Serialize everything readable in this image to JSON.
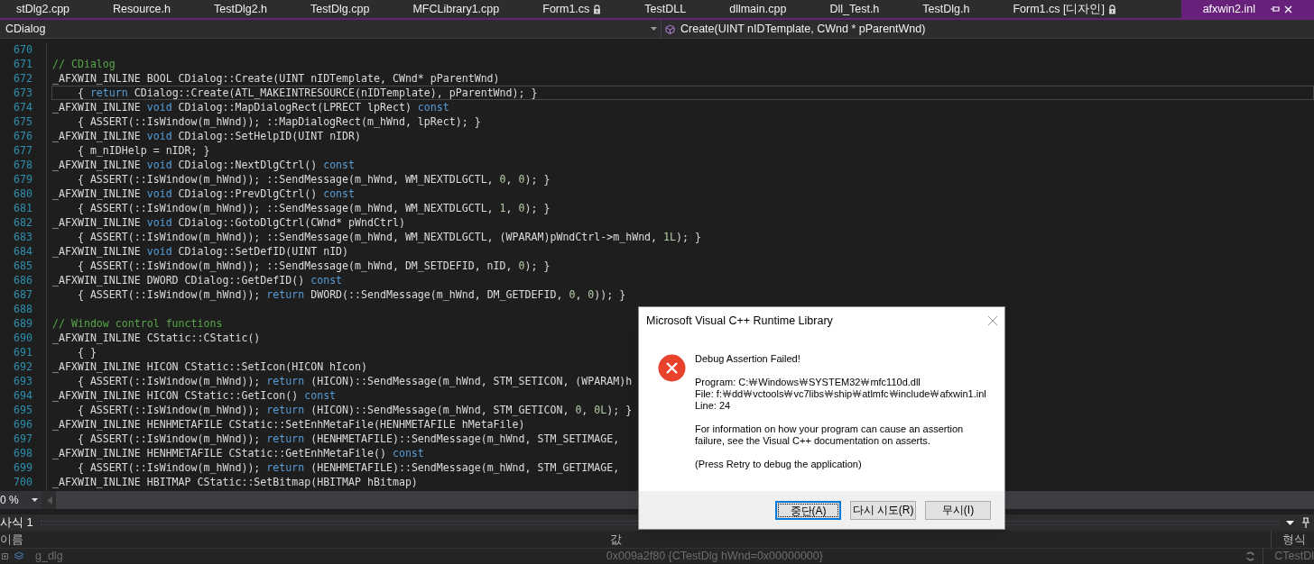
{
  "tabs": [
    {
      "label": "stDlg2.cpp",
      "selected": false,
      "locked": false
    },
    {
      "label": "Resource.h",
      "selected": false,
      "locked": false
    },
    {
      "label": "TestDlg2.h",
      "selected": false,
      "locked": false
    },
    {
      "label": "TestDlg.cpp",
      "selected": false,
      "locked": false
    },
    {
      "label": "MFCLibrary1.cpp",
      "selected": false,
      "locked": false
    },
    {
      "label": "Form1.cs",
      "selected": false,
      "locked": true
    },
    {
      "label": "TestDLL",
      "selected": false,
      "locked": false
    },
    {
      "label": "dllmain.cpp",
      "selected": false,
      "locked": false
    },
    {
      "label": "Dll_Test.h",
      "selected": false,
      "locked": false
    },
    {
      "label": "TestDlg.h",
      "selected": false,
      "locked": false
    },
    {
      "label": "Form1.cs [디자인]",
      "selected": false,
      "locked": true
    },
    {
      "label": "afxwin2.inl",
      "selected": true,
      "locked": false
    }
  ],
  "nav": {
    "scope": "CDialog",
    "member": "Create(UINT nIDTemplate, CWnd * pParentWnd)"
  },
  "code": [
    {
      "no": "670",
      "current": false
    },
    {
      "no": "671",
      "current": false,
      "segs": [
        {
          "kind": "comment",
          "text": "// CDialog"
        }
      ]
    },
    {
      "no": "672",
      "current": false,
      "segs": [
        {
          "kind": "plain",
          "text": "_AFXWIN_INLINE BOOL CDialog::Create(UINT nIDTemplate, CWnd* pParentWnd)"
        }
      ]
    },
    {
      "no": "673",
      "current": true,
      "segs": [
        {
          "kind": "plain",
          "text": "    { "
        },
        {
          "kind": "kw",
          "text": "return"
        },
        {
          "kind": "plain",
          "text": " CDialog::Create(ATL_MAKEINTRESOURCE(nIDTemplate), pParentWnd); }"
        }
      ]
    },
    {
      "no": "674",
      "current": false,
      "segs": [
        {
          "kind": "plain",
          "text": "_AFXWIN_INLINE "
        },
        {
          "kind": "kw",
          "text": "void"
        },
        {
          "kind": "plain",
          "text": " CDialog::MapDialogRect(LPRECT lpRect) "
        },
        {
          "kind": "kw",
          "text": "const"
        }
      ]
    },
    {
      "no": "675",
      "current": false,
      "segs": [
        {
          "kind": "plain",
          "text": "    { ASSERT(::IsWindow(m_hWnd)); ::MapDialogRect(m_hWnd, lpRect); }"
        }
      ]
    },
    {
      "no": "676",
      "current": false,
      "segs": [
        {
          "kind": "plain",
          "text": "_AFXWIN_INLINE "
        },
        {
          "kind": "kw",
          "text": "void"
        },
        {
          "kind": "plain",
          "text": " CDialog::SetHelpID(UINT nIDR)"
        }
      ]
    },
    {
      "no": "677",
      "current": false,
      "segs": [
        {
          "kind": "plain",
          "text": "    { m_nIDHelp = nIDR; }"
        }
      ]
    },
    {
      "no": "678",
      "current": false,
      "segs": [
        {
          "kind": "plain",
          "text": "_AFXWIN_INLINE "
        },
        {
          "kind": "kw",
          "text": "void"
        },
        {
          "kind": "plain",
          "text": " CDialog::NextDlgCtrl() "
        },
        {
          "kind": "kw",
          "text": "const"
        }
      ]
    },
    {
      "no": "679",
      "current": false,
      "segs": [
        {
          "kind": "plain",
          "text": "    { ASSERT(::IsWindow(m_hWnd)); ::SendMessage(m_hWnd, WM_NEXTDLGCTL, "
        },
        {
          "kind": "num",
          "text": "0"
        },
        {
          "kind": "plain",
          "text": ", "
        },
        {
          "kind": "num",
          "text": "0"
        },
        {
          "kind": "plain",
          "text": "); }"
        }
      ]
    },
    {
      "no": "680",
      "current": false,
      "segs": [
        {
          "kind": "plain",
          "text": "_AFXWIN_INLINE "
        },
        {
          "kind": "kw",
          "text": "void"
        },
        {
          "kind": "plain",
          "text": " CDialog::PrevDlgCtrl() "
        },
        {
          "kind": "kw",
          "text": "const"
        }
      ]
    },
    {
      "no": "681",
      "current": false,
      "segs": [
        {
          "kind": "plain",
          "text": "    { ASSERT(::IsWindow(m_hWnd)); ::SendMessage(m_hWnd, WM_NEXTDLGCTL, "
        },
        {
          "kind": "num",
          "text": "1"
        },
        {
          "kind": "plain",
          "text": ", "
        },
        {
          "kind": "num",
          "text": "0"
        },
        {
          "kind": "plain",
          "text": "); }"
        }
      ]
    },
    {
      "no": "682",
      "current": false,
      "segs": [
        {
          "kind": "plain",
          "text": "_AFXWIN_INLINE "
        },
        {
          "kind": "kw",
          "text": "void"
        },
        {
          "kind": "plain",
          "text": " CDialog::GotoDlgCtrl(CWnd* pWndCtrl)"
        }
      ]
    },
    {
      "no": "683",
      "current": false,
      "segs": [
        {
          "kind": "plain",
          "text": "    { ASSERT(::IsWindow(m_hWnd)); ::SendMessage(m_hWnd, WM_NEXTDLGCTL, (WPARAM)pWndCtrl->m_hWnd, "
        },
        {
          "kind": "num",
          "text": "1L"
        },
        {
          "kind": "plain",
          "text": "); }"
        }
      ]
    },
    {
      "no": "684",
      "current": false,
      "segs": [
        {
          "kind": "plain",
          "text": "_AFXWIN_INLINE "
        },
        {
          "kind": "kw",
          "text": "void"
        },
        {
          "kind": "plain",
          "text": " CDialog::SetDefID(UINT nID)"
        }
      ]
    },
    {
      "no": "685",
      "current": false,
      "segs": [
        {
          "kind": "plain",
          "text": "    { ASSERT(::IsWindow(m_hWnd)); ::SendMessage(m_hWnd, DM_SETDEFID, nID, "
        },
        {
          "kind": "num",
          "text": "0"
        },
        {
          "kind": "plain",
          "text": "); }"
        }
      ]
    },
    {
      "no": "686",
      "current": false,
      "segs": [
        {
          "kind": "plain",
          "text": "_AFXWIN_INLINE DWORD CDialog::GetDefID() "
        },
        {
          "kind": "kw",
          "text": "const"
        }
      ]
    },
    {
      "no": "687",
      "current": false,
      "segs": [
        {
          "kind": "plain",
          "text": "    { ASSERT(::IsWindow(m_hWnd)); "
        },
        {
          "kind": "kw",
          "text": "return"
        },
        {
          "kind": "plain",
          "text": " DWORD(::SendMessage(m_hWnd, DM_GETDEFID, "
        },
        {
          "kind": "num",
          "text": "0"
        },
        {
          "kind": "plain",
          "text": ", "
        },
        {
          "kind": "num",
          "text": "0"
        },
        {
          "kind": "plain",
          "text": ")); }"
        }
      ]
    },
    {
      "no": "688",
      "current": false
    },
    {
      "no": "689",
      "current": false,
      "segs": [
        {
          "kind": "comment",
          "text": "// Window control functions"
        }
      ]
    },
    {
      "no": "690",
      "current": false,
      "segs": [
        {
          "kind": "plain",
          "text": "_AFXWIN_INLINE CStatic::CStatic()"
        }
      ]
    },
    {
      "no": "691",
      "current": false,
      "segs": [
        {
          "kind": "plain",
          "text": "    { }"
        }
      ]
    },
    {
      "no": "692",
      "current": false,
      "segs": [
        {
          "kind": "plain",
          "text": "_AFXWIN_INLINE HICON CStatic::SetIcon(HICON hIcon)"
        }
      ]
    },
    {
      "no": "693",
      "current": false,
      "segs": [
        {
          "kind": "plain",
          "text": "    { ASSERT(::IsWindow(m_hWnd)); "
        },
        {
          "kind": "kw",
          "text": "return"
        },
        {
          "kind": "plain",
          "text": " (HICON)::SendMessage(m_hWnd, STM_SETICON, (WPARAM)h"
        }
      ]
    },
    {
      "no": "694",
      "current": false,
      "segs": [
        {
          "kind": "plain",
          "text": "_AFXWIN_INLINE HICON CStatic::GetIcon() "
        },
        {
          "kind": "kw",
          "text": "const"
        }
      ]
    },
    {
      "no": "695",
      "current": false,
      "segs": [
        {
          "kind": "plain",
          "text": "    { ASSERT(::IsWindow(m_hWnd)); "
        },
        {
          "kind": "kw",
          "text": "return"
        },
        {
          "kind": "plain",
          "text": " (HICON)::SendMessage(m_hWnd, STM_GETICON, "
        },
        {
          "kind": "num",
          "text": "0"
        },
        {
          "kind": "plain",
          "text": ", "
        },
        {
          "kind": "num",
          "text": "0L"
        },
        {
          "kind": "plain",
          "text": "); }"
        }
      ]
    },
    {
      "no": "696",
      "current": false,
      "segs": [
        {
          "kind": "plain",
          "text": "_AFXWIN_INLINE HENHMETAFILE CStatic::SetEnhMetaFile(HENHMETAFILE hMetaFile)"
        }
      ]
    },
    {
      "no": "697",
      "current": false,
      "segs": [
        {
          "kind": "plain",
          "text": "    { ASSERT(::IsWindow(m_hWnd)); "
        },
        {
          "kind": "kw",
          "text": "return"
        },
        {
          "kind": "plain",
          "text": " (HENHMETAFILE)::SendMessage(m_hWnd, STM_SETIMAGE,"
        }
      ]
    },
    {
      "no": "698",
      "current": false,
      "segs": [
        {
          "kind": "plain",
          "text": "_AFXWIN_INLINE HENHMETAFILE CStatic::GetEnhMetaFile() "
        },
        {
          "kind": "kw",
          "text": "const"
        }
      ]
    },
    {
      "no": "699",
      "current": false,
      "segs": [
        {
          "kind": "plain",
          "text": "    { ASSERT(::IsWindow(m_hWnd)); "
        },
        {
          "kind": "kw",
          "text": "return"
        },
        {
          "kind": "plain",
          "text": " (HENHMETAFILE)::SendMessage(m_hWnd, STM_GETIMAGE,"
        }
      ]
    },
    {
      "no": "700",
      "current": false,
      "segs": [
        {
          "kind": "plain",
          "text": "_AFXWIN_INLINE HBITMAP CStatic::SetBitmap(HBITMAP hBitmap)"
        }
      ]
    }
  ],
  "zoom": "0 %",
  "watch": {
    "title": "사식 1",
    "columns": [
      "이름",
      "값",
      "형식"
    ],
    "rows": [
      {
        "name": "g_dlg",
        "value": "0x009a2f80 {CTestDlg hWnd=0x00000000}",
        "type": "CTestDl"
      }
    ]
  },
  "dialog": {
    "title": "Microsoft Visual C++ Runtime Library",
    "heading": "Debug Assertion Failed!",
    "details": [
      "Program: C:￦Windows￦SYSTEM32￦mfc110d.dll",
      "File: f:￦dd￦vctools￦vc7libs￦ship￦atlmfc￦include￦afxwin1.inl",
      "Line: 24"
    ],
    "info": "For information on how your program can cause an assertion failure, see the Visual C++ documentation on asserts.",
    "hint": "(Press Retry to debug the application)",
    "buttons": [
      {
        "label": "중단(A)",
        "selected": true
      },
      {
        "label": "다시 시도(R)",
        "selected": false
      },
      {
        "label": "무시(I)",
        "selected": false
      }
    ]
  }
}
